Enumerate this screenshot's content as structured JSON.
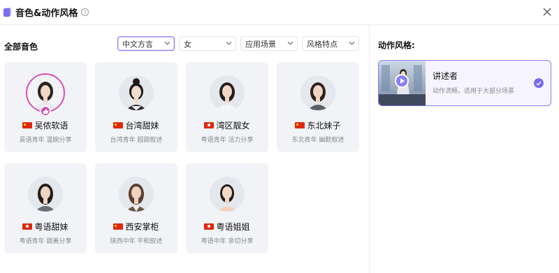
{
  "header": {
    "title": "音色&动作风格"
  },
  "voices": {
    "section_title": "全部音色",
    "filters": [
      {
        "label": "中文方言",
        "active": true
      },
      {
        "label": "女",
        "active": false
      },
      {
        "label": "应用场景",
        "active": false
      },
      {
        "label": "风格特点",
        "active": false
      }
    ],
    "cards": [
      {
        "name": "吴侬软语",
        "tags": "吴语青年 温婉分享",
        "flag": "cn",
        "selected": true
      },
      {
        "name": "台湾甜妹",
        "tags": "台湾青年 超甜叙述",
        "flag": "cn",
        "selected": false
      },
      {
        "name": "湾区靓女",
        "tags": "粤语青年 活力分享",
        "flag": "hk",
        "selected": false
      },
      {
        "name": "东北妹子",
        "tags": "东北青年 幽默叙述",
        "flag": "cn",
        "selected": false
      },
      {
        "name": "粤语甜妹",
        "tags": "粤语青年 甜美分享",
        "flag": "hk",
        "selected": false
      },
      {
        "name": "西安掌柜",
        "tags": "陕西中年 平和叙述",
        "flag": "cn",
        "selected": false
      },
      {
        "name": "粤语姐姐",
        "tags": "粤语中年 亲切分享",
        "flag": "hk",
        "selected": false
      }
    ]
  },
  "motion": {
    "section_title": "动作风格:",
    "option": {
      "name": "讲述者",
      "desc": "动作流畅，适用于大部分场景",
      "selected": true
    }
  },
  "colors": {
    "accent": "#8b7ff3",
    "selected_ring": "#d94fb4",
    "card_bg": "#f1f3f6"
  }
}
